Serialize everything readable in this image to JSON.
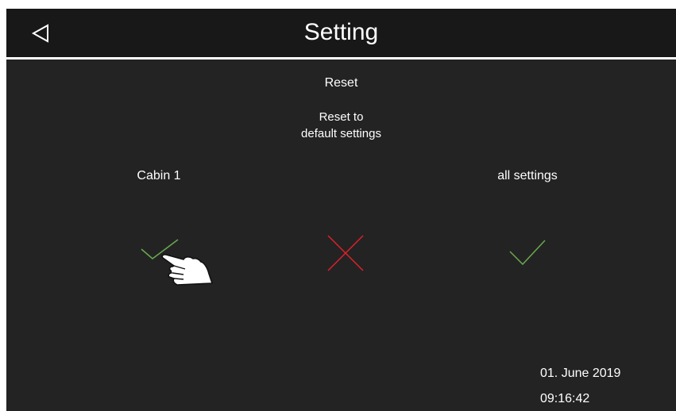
{
  "header": {
    "title": "Setting",
    "back_icon": "back-triangle-icon"
  },
  "reset": {
    "title": "Reset",
    "description_line1": "Reset to",
    "description_line2": "default settings"
  },
  "options": {
    "left_label": "Cabin 1",
    "right_label": "all settings"
  },
  "actions": {
    "left_icon": "checkmark-icon",
    "center_icon": "cross-icon",
    "right_icon": "checkmark-icon"
  },
  "status": {
    "date": "01. June 2019",
    "time": "09:16:42"
  },
  "colors": {
    "background": "#232323",
    "header": "#181818",
    "text": "#ffffff",
    "confirm": "#6aa84f",
    "cancel": "#e0202a"
  }
}
